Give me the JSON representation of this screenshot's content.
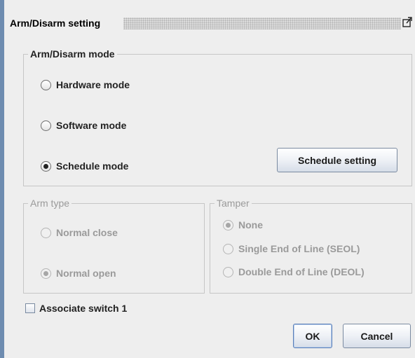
{
  "window": {
    "title": "Arm/Disarm setting"
  },
  "arm_disarm_mode": {
    "legend": "Arm/Disarm mode",
    "options": [
      {
        "label": "Hardware mode",
        "selected": false
      },
      {
        "label": "Software mode",
        "selected": false
      },
      {
        "label": "Schedule mode",
        "selected": true
      }
    ],
    "schedule_button": "Schedule setting"
  },
  "arm_type": {
    "legend": "Arm type",
    "enabled": false,
    "options": [
      {
        "label": "Normal close",
        "selected": false
      },
      {
        "label": "Normal open",
        "selected": true
      }
    ]
  },
  "tamper": {
    "legend": "Tamper",
    "enabled": false,
    "options": [
      {
        "label": "None",
        "selected": true
      },
      {
        "label": "Single End of Line (SEOL)",
        "selected": false
      },
      {
        "label": "Double End of Line (DEOL)",
        "selected": false
      }
    ]
  },
  "associate_switch": {
    "label": "Associate switch 1",
    "checked": false
  },
  "buttons": {
    "ok": "OK",
    "cancel": "Cancel"
  },
  "colors": {
    "window_border": "#6e8cb0",
    "background": "#eeeeee",
    "disabled_text": "#9a9a9a"
  }
}
